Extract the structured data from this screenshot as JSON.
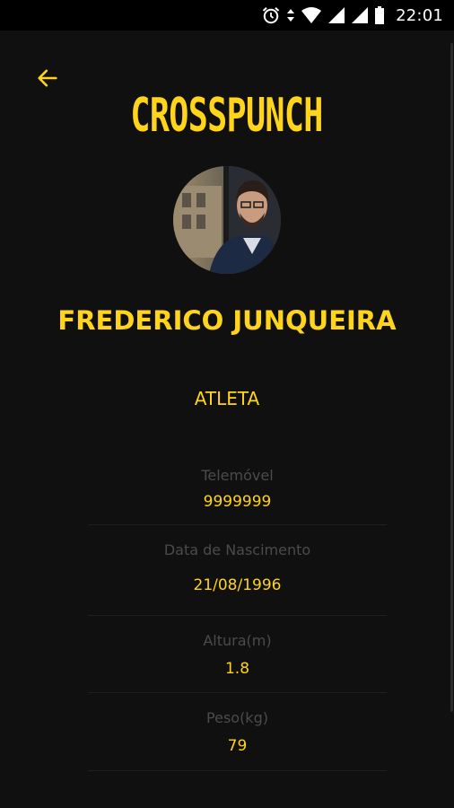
{
  "status_bar": {
    "time": "22:01",
    "icons": [
      "alarm-icon",
      "data-arrows-icon",
      "wifi-icon",
      "signal-icon",
      "signal-icon-2",
      "battery-icon"
    ]
  },
  "header": {
    "back_icon": "arrow-left-icon",
    "brand": "CROSSPUNCH"
  },
  "profile": {
    "avatar": "profile-photo",
    "name": "FREDERICO JUNQUEIRA",
    "role": "ATLETA"
  },
  "info": [
    {
      "label": "Telemóvel",
      "value": "9999999"
    },
    {
      "label": "Data de Nascimento",
      "value": "21/08/1996"
    },
    {
      "label": "Altura(m)",
      "value": "1.8"
    },
    {
      "label": "Peso(kg)",
      "value": "79"
    }
  ],
  "colors": {
    "accent": "#FFD41A",
    "background": "#101010",
    "label": "#4B4B4B",
    "divider": "#1F1F1F"
  }
}
